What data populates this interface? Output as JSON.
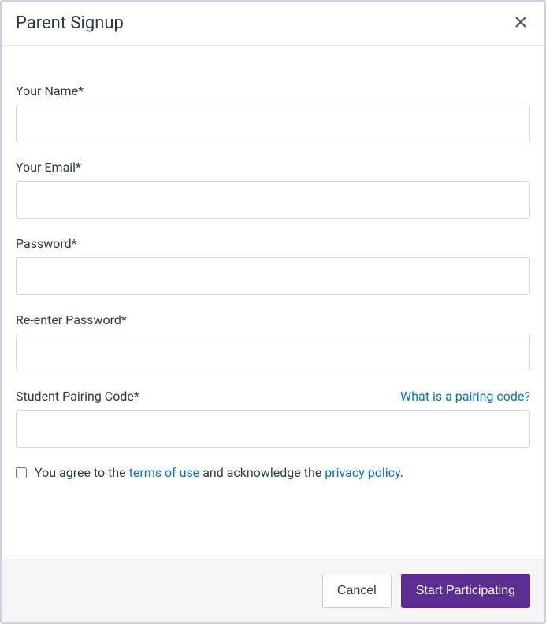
{
  "modal": {
    "title": "Parent Signup"
  },
  "form": {
    "name": {
      "label": "Your Name*",
      "value": ""
    },
    "email": {
      "label": "Your Email*",
      "value": ""
    },
    "password": {
      "label": "Password*",
      "value": ""
    },
    "repassword": {
      "label": "Re-enter Password*",
      "value": ""
    },
    "pairing": {
      "label": "Student Pairing Code*",
      "help_link": "What is a pairing code?",
      "value": ""
    },
    "agree": {
      "prefix": "You agree to the ",
      "terms_link": "terms of use",
      "mid": " and acknowledge the ",
      "privacy_link": "privacy policy",
      "suffix": "."
    }
  },
  "footer": {
    "cancel": "Cancel",
    "submit": "Start Participating"
  },
  "colors": {
    "primary": "#5b2d91",
    "link": "#0374b5"
  }
}
